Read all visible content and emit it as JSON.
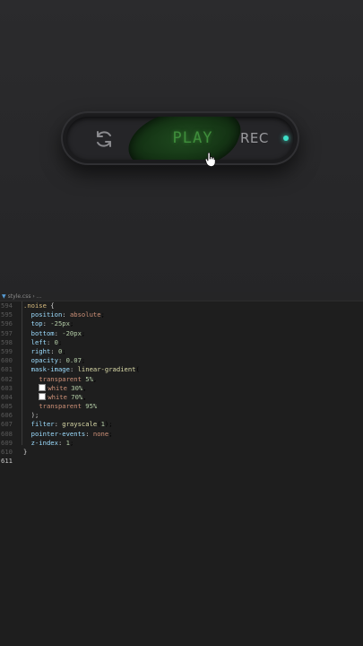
{
  "controls": {
    "reset_icon": "refresh-icon",
    "play_label": "PLAY",
    "rec_label": "REC",
    "led_color": "#3ee0c8",
    "play_color": "#3f8e3c"
  },
  "editor": {
    "tab_title": "style.css › ...",
    "lines": [
      {
        "n": "594",
        "t": ".noise {"
      },
      {
        "n": "595",
        "t": "  position: absolute;"
      },
      {
        "n": "596",
        "t": "  top: -25px;"
      },
      {
        "n": "597",
        "t": "  bottom: -20px;"
      },
      {
        "n": "598",
        "t": "  left: 0;"
      },
      {
        "n": "599",
        "t": "  right: 0;"
      },
      {
        "n": "600",
        "t": "  opacity: 0.07;"
      },
      {
        "n": "601",
        "t": "  mask-image: linear-gradient("
      },
      {
        "n": "602",
        "t": "    transparent 5%,"
      },
      {
        "n": "603",
        "t": "    white 30%,"
      },
      {
        "n": "604",
        "t": "    white 70%,"
      },
      {
        "n": "605",
        "t": "    transparent 95%"
      },
      {
        "n": "606",
        "t": "  );"
      },
      {
        "n": "607",
        "t": "  filter: grayscale(1);"
      },
      {
        "n": "608",
        "t": "  pointer-events: none;"
      },
      {
        "n": "609",
        "t": "  z-index: 1;"
      },
      {
        "n": "610",
        "t": "}"
      },
      {
        "n": "611",
        "t": ""
      }
    ]
  }
}
